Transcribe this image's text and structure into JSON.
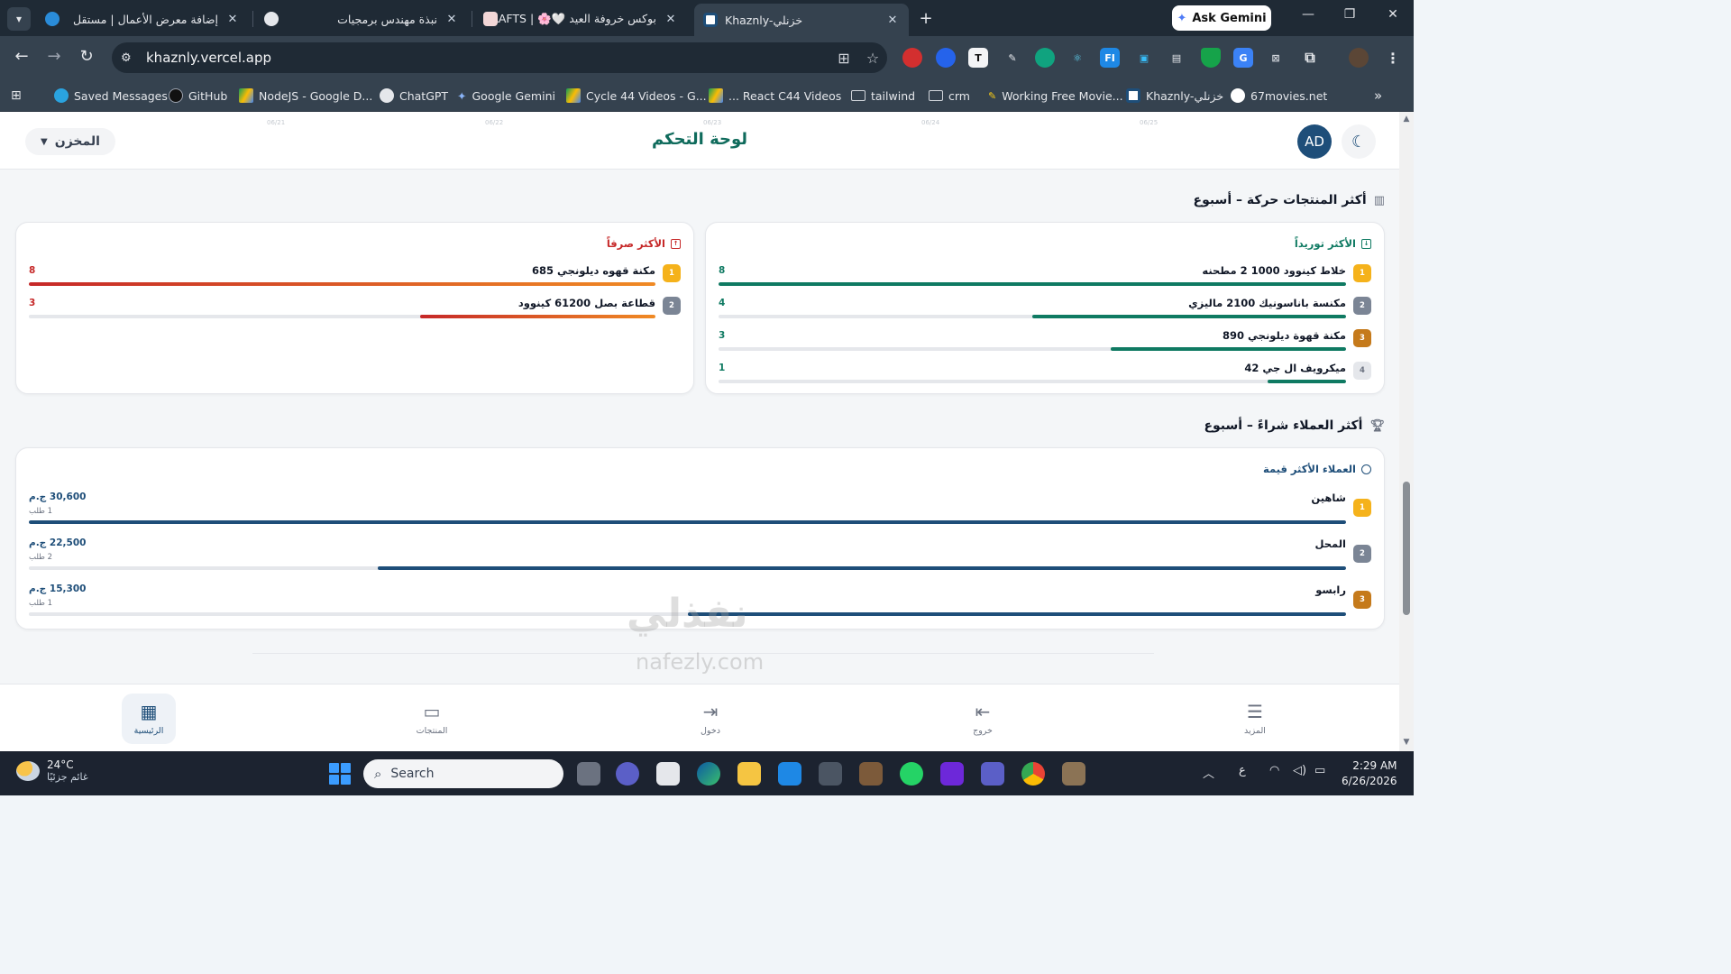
{
  "browser": {
    "tabs": [
      {
        "title": "إضافة معرض الأعمال | مستقل",
        "active": false
      },
      {
        "title": "نبذة مهندس برمجيات",
        "active": false
      },
      {
        "title": "بوكس خروفة العيد 🤍🌸 | RAFTS",
        "active": false
      },
      {
        "title": "Khaznly-خزنلي",
        "active": true
      }
    ],
    "new_tab": "+",
    "ask_gemini": "Ask Gemini",
    "url": "khaznly.vercel.app",
    "bookmarks": [
      "Saved Messages",
      "GitHub",
      "NodeJS - Google D...",
      "ChatGPT",
      "Google Gemini",
      "Cycle 44 Videos - G...",
      "React C44 Videos ...",
      "tailwind",
      "crm",
      "Working Free Movie...",
      "Khaznly-خزنلي",
      "67movies.net"
    ],
    "bookmarks_more": "»"
  },
  "header": {
    "title": "لوحة التحكم",
    "avatar": "AD",
    "warehouse": "المخزن",
    "ghost_dates": [
      "06/21",
      "06/22",
      "06/23",
      "06/24",
      "06/25"
    ]
  },
  "top_products": {
    "heading": "أكثر المنتجات حركة – أسبوع",
    "supplied": {
      "title": "الأكثر توريداً",
      "color": "#0f7a62",
      "max": 8,
      "items": [
        {
          "rank": "1",
          "name": "خلاط كينوود 1000 2 مطحنه",
          "value": 8
        },
        {
          "rank": "2",
          "name": "مكنسة باناسونيك 2100 ماليزي",
          "value": 4
        },
        {
          "rank": "3",
          "name": "مكنة قهوة ديلونجي 890",
          "value": 3
        },
        {
          "rank": "4",
          "name": "ميكرويف ال جي 42",
          "value": 1
        }
      ]
    },
    "consumed": {
      "title": "الأكثر صرفاً",
      "color": "#c62828",
      "max": 8,
      "items": [
        {
          "rank": "1",
          "name": "مكنة قهوه ديلونجي 685",
          "value": 8
        },
        {
          "rank": "2",
          "name": "قطاعة بصل 61200 كينوود",
          "value": 3
        }
      ]
    }
  },
  "top_customers": {
    "heading": "أكثر العملاء شراءً – أسبوع",
    "card_title": "العملاء الأكثر قيمة",
    "color": "#1e4e79",
    "max": 30600,
    "items": [
      {
        "rank": "1",
        "name": "شاهين",
        "amount": "30,600 ج.م",
        "value": 30600,
        "orders": "1 طلب"
      },
      {
        "rank": "2",
        "name": "المحل",
        "amount": "22,500 ج.م",
        "value": 22500,
        "orders": "2 طلب"
      },
      {
        "rank": "3",
        "name": "رابسو",
        "amount": "15,300 ج.م",
        "value": 15300,
        "orders": "1 طلب"
      }
    ]
  },
  "rank_colors": [
    "#f5b21b",
    "#7b8595",
    "#c57a1b",
    "#e5e7eb"
  ],
  "bottom_nav": [
    {
      "label": "الرئيسية",
      "icon": "dashboard-icon",
      "active": true
    },
    {
      "label": "المنتجات",
      "icon": "archive-icon",
      "active": false
    },
    {
      "label": "دخول",
      "icon": "login-icon",
      "active": false
    },
    {
      "label": "خروج",
      "icon": "logout-icon",
      "active": false
    },
    {
      "label": "المزيد",
      "icon": "menu-icon",
      "active": false
    }
  ],
  "watermark": {
    "arabic": "نفذلي",
    "latin": "nafezly.com"
  },
  "taskbar": {
    "temperature": "24°C",
    "condition": "غائم جزئيًا",
    "search": "Search",
    "keyboard": "ع",
    "time": "2:29 AM",
    "date": "6/26/2026"
  }
}
